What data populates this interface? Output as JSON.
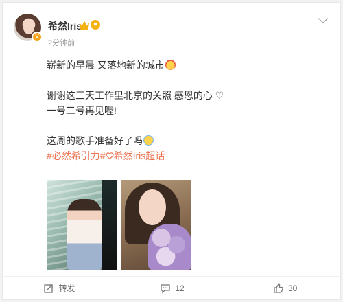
{
  "post": {
    "username": "希然Iris",
    "level": "V",
    "time": "2分钟前",
    "lines": [
      "崭新的早晨 又落地新的城市",
      "谢谢这三天工作里北京的关照 感恩的心 ♡",
      "一号二号再见喔!",
      "这周的歌手准备好了吗"
    ],
    "tags": "#必然希引力#",
    "super_topic": "希然Iris超话"
  },
  "actions": {
    "repost": "转发",
    "comments": "12",
    "likes": "30"
  },
  "colors": {
    "accent": "#eb7350",
    "badge": "#f7a21b"
  },
  "icons": {
    "repost": "repost-icon",
    "comment": "comment-icon",
    "like": "thumbs-up-icon",
    "menu": "chevron-down-icon"
  }
}
